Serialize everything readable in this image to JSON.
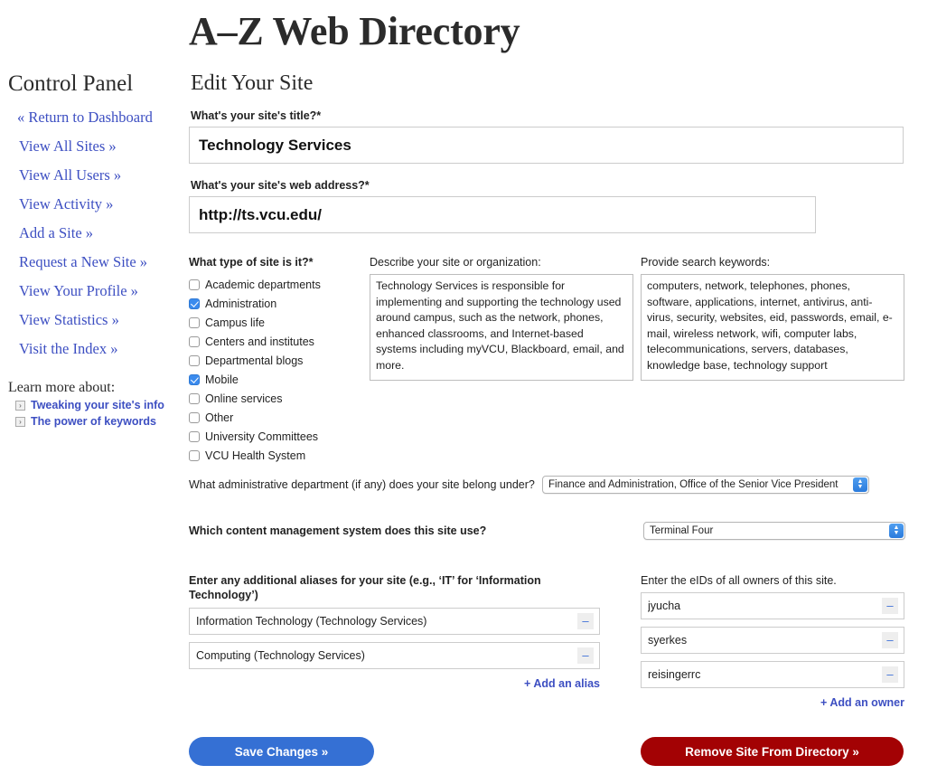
{
  "site": {
    "masthead": "A–Z Web Directory"
  },
  "sidebar": {
    "panel_title": "Control Panel",
    "items": [
      {
        "label": "« Return to Dashboard"
      },
      {
        "label": "View All Sites »"
      },
      {
        "label": "View All Users »"
      },
      {
        "label": "View Activity »"
      },
      {
        "label": "Add a Site »"
      },
      {
        "label": "Request a New Site »"
      },
      {
        "label": "View Your Profile »"
      },
      {
        "label": "View Statistics »"
      },
      {
        "label": "Visit the Index »"
      }
    ],
    "learn_more": {
      "title": "Learn more about:",
      "arrow_icon": "chevron-right-icon",
      "links": [
        {
          "label": "Tweaking your site's info"
        },
        {
          "label": "The power of keywords"
        }
      ]
    }
  },
  "main": {
    "page_title": "Edit Your Site",
    "title_field": {
      "label": "What's your site's title?*",
      "value": "Technology Services",
      "placeholder": ""
    },
    "url_field": {
      "label": "What's your site's web address?*",
      "value": "http://ts.vcu.edu/",
      "placeholder": ""
    },
    "site_type": {
      "label": "What type of site is it?*",
      "options": [
        {
          "label": "Academic departments",
          "checked": false
        },
        {
          "label": "Administration",
          "checked": true
        },
        {
          "label": "Campus life",
          "checked": false
        },
        {
          "label": "Centers and institutes",
          "checked": false
        },
        {
          "label": "Departmental blogs",
          "checked": false
        },
        {
          "label": "Mobile",
          "checked": true
        },
        {
          "label": "Online services",
          "checked": false
        },
        {
          "label": "Other",
          "checked": false
        },
        {
          "label": "University Committees",
          "checked": false
        },
        {
          "label": "VCU Health System",
          "checked": false
        }
      ]
    },
    "description": {
      "label": "Describe your site or organization:",
      "value": "Technology Services is responsible for implementing and supporting the technology used around campus, such as the network, phones, enhanced classrooms, and Internet-based systems including myVCU, Blackboard, email, and more.",
      "placeholder": ""
    },
    "keywords": {
      "label": "Provide search keywords:",
      "value": "computers, network, telephones, phones, software, applications, internet, antivirus, anti-virus, security, websites, eid, passwords, email, e-mail, wireless network, wifi, computer labs, telecommunications, servers, databases, knowledge base, technology support",
      "placeholder": ""
    },
    "department": {
      "label": "What administrative department (if any) does your site belong under?",
      "selected": "Finance and Administration, Office of the Senior Vice President"
    },
    "cms": {
      "label": "Which content management system does this site use?",
      "selected": "Terminal Four"
    },
    "aliases": {
      "label": "Enter any additional aliases for your site (e.g., ‘IT’ for ‘Information Technology’)",
      "rows": [
        {
          "value": "Information Technology (Technology Services)",
          "remove_label": "–"
        },
        {
          "value": "Computing (Technology Services)",
          "remove_label": "–"
        }
      ],
      "add_label": "+ Add an alias"
    },
    "owners": {
      "label": "Enter the eIDs of all owners of this site.",
      "rows": [
        {
          "value": "jyucha",
          "remove_label": "–"
        },
        {
          "value": "syerkes",
          "remove_label": "–"
        },
        {
          "value": "reisingerrc",
          "remove_label": "–"
        }
      ],
      "add_label": "+ Add an owner"
    },
    "actions": {
      "save_label": "Save Changes »",
      "remove_label": "Remove Site From Directory »"
    }
  },
  "colors": {
    "link_blue": "#3d4fc2",
    "save_blue": "#3570d4",
    "remove_red": "#a30204",
    "checkbox_blue": "#3b8bee"
  }
}
